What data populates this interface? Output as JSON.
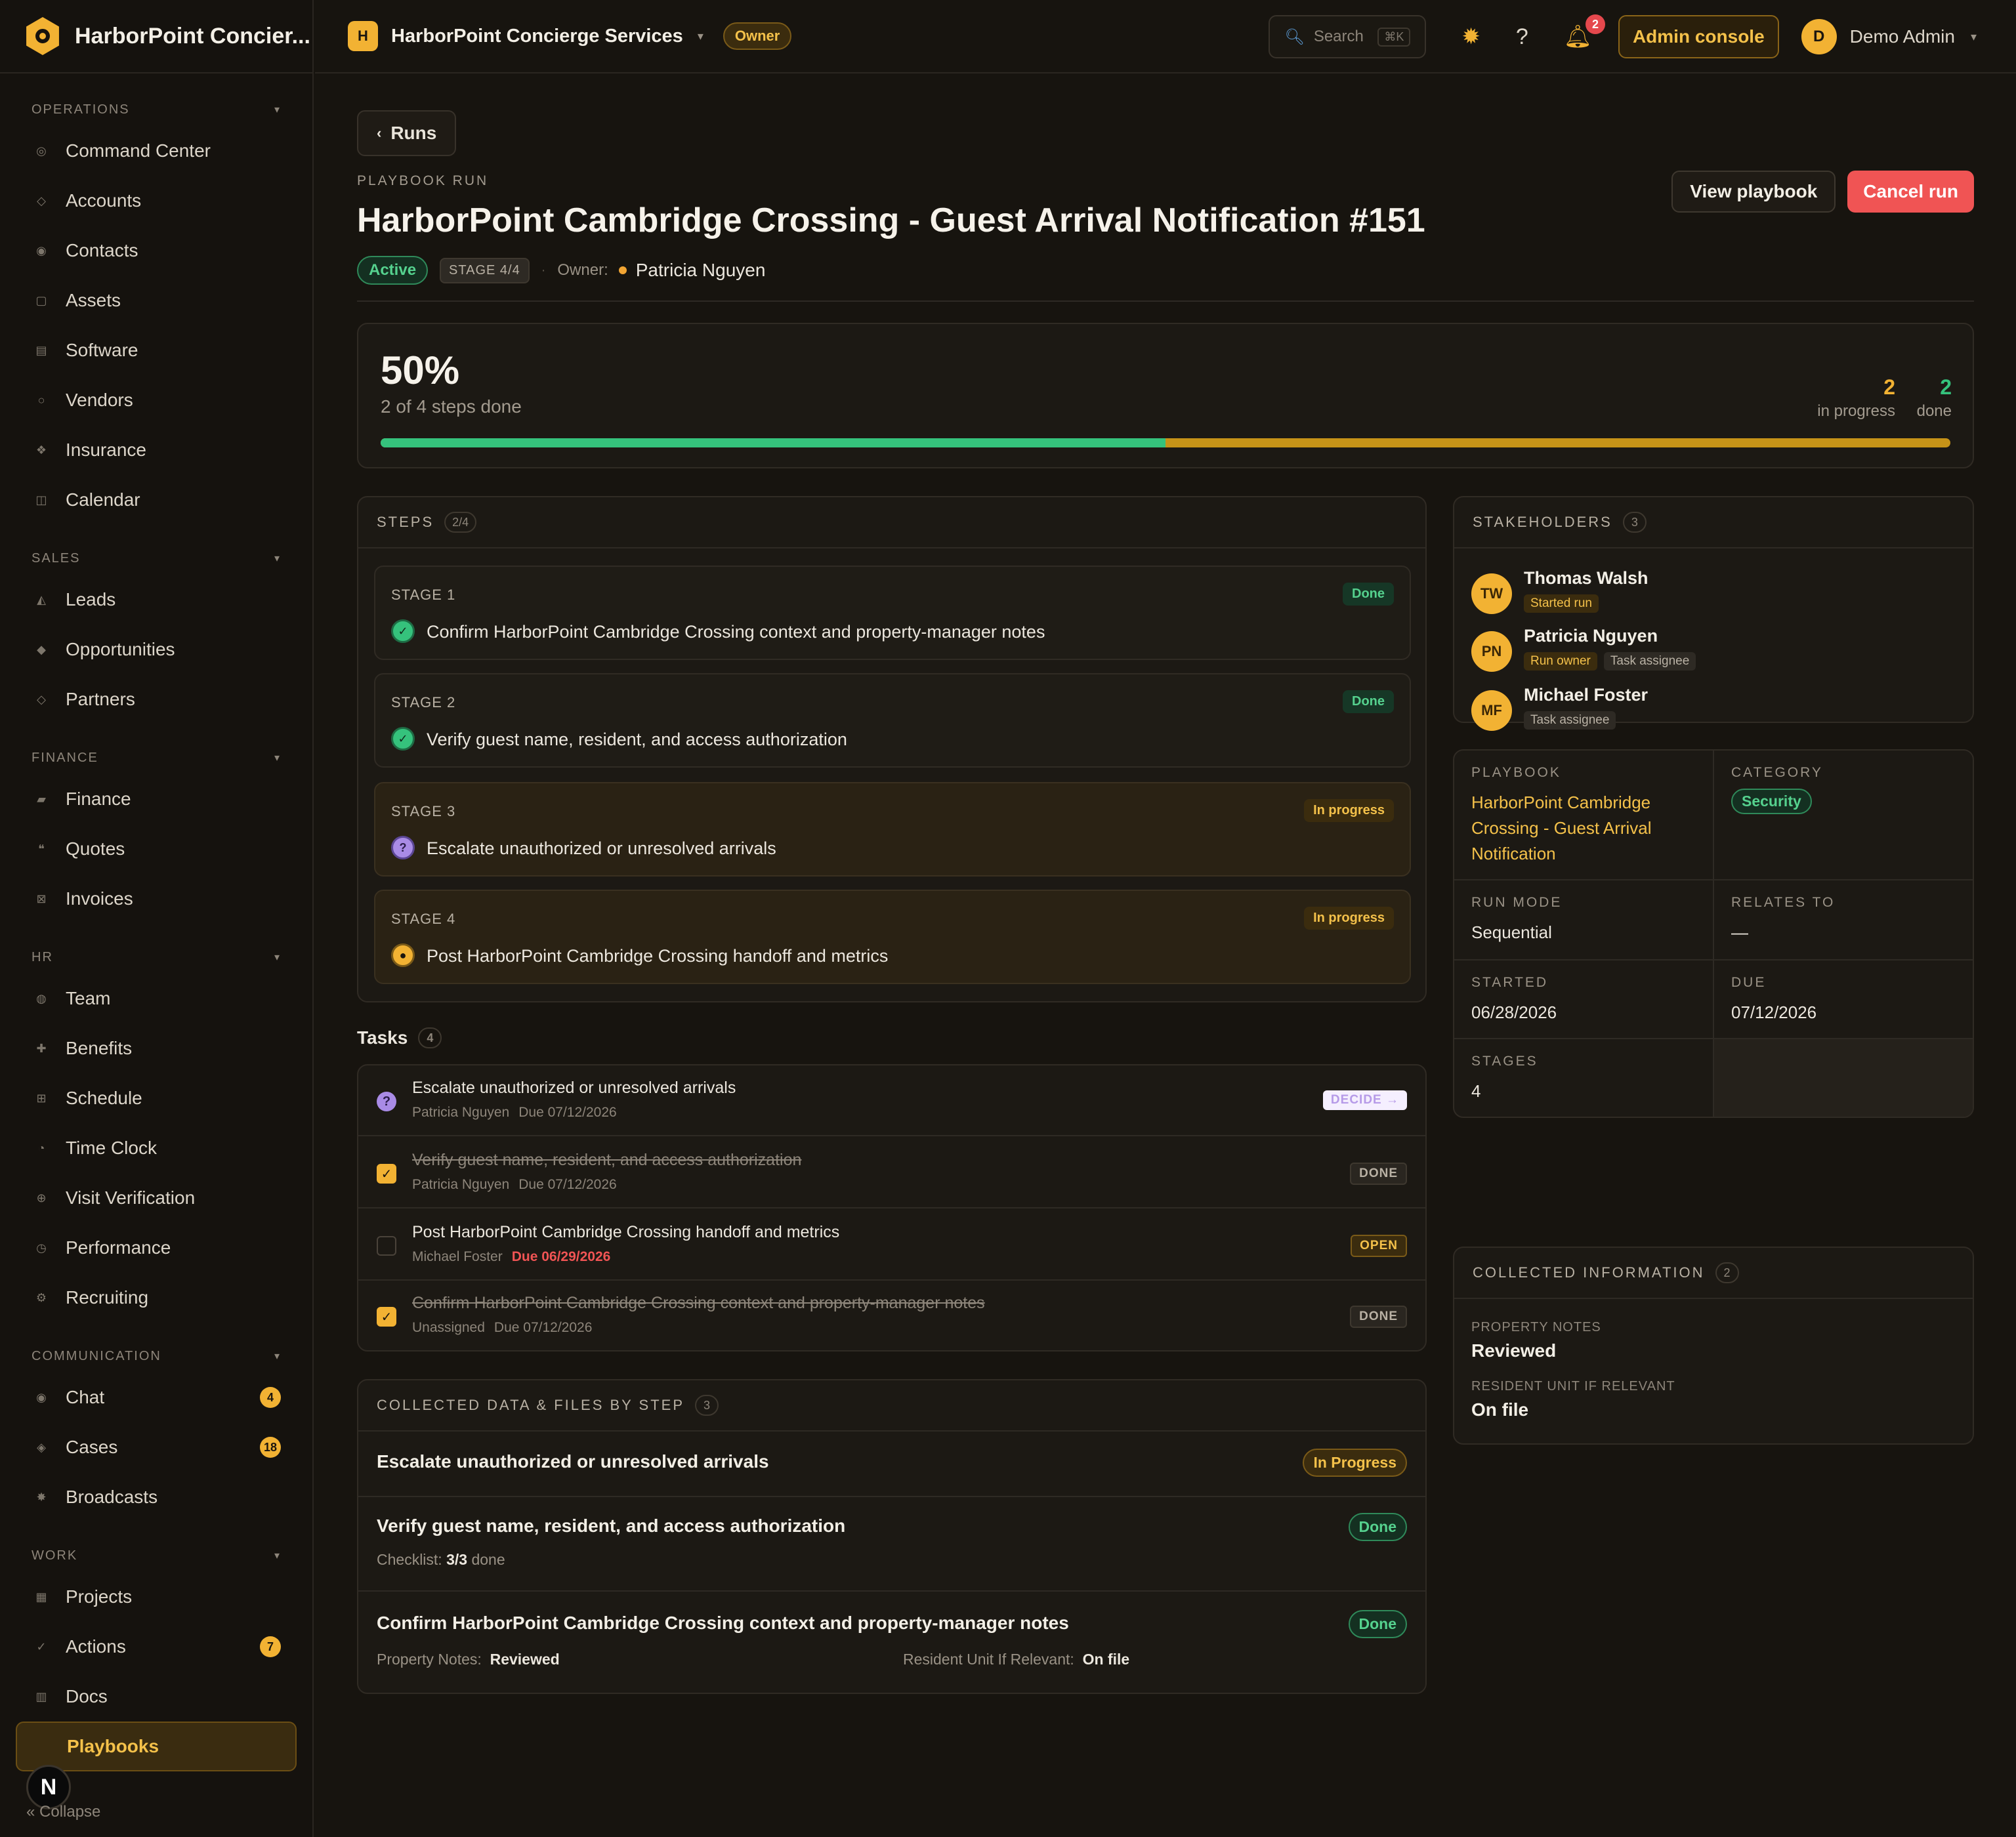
{
  "app": {
    "brand": "HarborPoint Concier...",
    "workspace": "HarborPoint Concierge Services",
    "role_badge": "Owner",
    "search_placeholder": "Search",
    "search_shortcut": "⌘K",
    "notifications_count": "2",
    "admin_console": "Admin console",
    "user_initial": "D",
    "user_name": "Demo Admin"
  },
  "sidebar": {
    "sections": [
      {
        "heading": "OPERATIONS",
        "items": [
          {
            "label": "Command Center",
            "icon": "target-icon"
          },
          {
            "label": "Accounts",
            "icon": "diamond-icon"
          },
          {
            "label": "Contacts",
            "icon": "person-icon"
          },
          {
            "label": "Assets",
            "icon": "box-icon"
          },
          {
            "label": "Software",
            "icon": "grid-icon"
          },
          {
            "label": "Vendors",
            "icon": "circle-icon"
          },
          {
            "label": "Insurance",
            "icon": "shield-icon"
          },
          {
            "label": "Calendar",
            "icon": "calendar-icon"
          }
        ]
      },
      {
        "heading": "SALES",
        "items": [
          {
            "label": "Leads",
            "icon": "triangle-icon"
          },
          {
            "label": "Opportunities",
            "icon": "diamond-filled-icon"
          },
          {
            "label": "Partners",
            "icon": "diamond-icon"
          }
        ]
      },
      {
        "heading": "FINANCE",
        "items": [
          {
            "label": "Finance",
            "icon": "card-icon"
          },
          {
            "label": "Quotes",
            "icon": "quote-icon"
          },
          {
            "label": "Invoices",
            "icon": "invoice-icon"
          }
        ]
      },
      {
        "heading": "HR",
        "items": [
          {
            "label": "Team",
            "icon": "team-icon"
          },
          {
            "label": "Benefits",
            "icon": "plus-icon"
          },
          {
            "label": "Schedule",
            "icon": "schedule-icon"
          },
          {
            "label": "Time Clock",
            "icon": "clock-icon"
          },
          {
            "label": "Visit Verification",
            "icon": "globe-icon"
          },
          {
            "label": "Performance",
            "icon": "gauge-icon"
          },
          {
            "label": "Recruiting",
            "icon": "gear-icon"
          }
        ]
      },
      {
        "heading": "COMMUNICATION",
        "items": [
          {
            "label": "Chat",
            "icon": "chat-icon",
            "badge": "4"
          },
          {
            "label": "Cases",
            "icon": "case-icon",
            "badge": "18"
          },
          {
            "label": "Broadcasts",
            "icon": "broadcast-icon"
          }
        ]
      },
      {
        "heading": "WORK",
        "items": [
          {
            "label": "Projects",
            "icon": "projects-icon"
          },
          {
            "label": "Actions",
            "icon": "check-icon",
            "badge": "7"
          },
          {
            "label": "Docs",
            "icon": "doc-icon"
          }
        ]
      }
    ],
    "active_item": "Playbooks",
    "collapse_label": "« Collapse",
    "bottom_avatar": "N"
  },
  "run": {
    "back_label": "Runs",
    "eyebrow": "PLAYBOOK RUN",
    "title": "HarborPoint Cambridge Crossing - Guest Arrival Notification #151",
    "status": "Active",
    "stage_chip": "STAGE 4/4",
    "owner_label": "Owner:",
    "owner_name": "Patricia Nguyen",
    "view_playbook": "View playbook",
    "cancel_run": "Cancel run"
  },
  "progress": {
    "percent_label": "50%",
    "percent_value": 0.5,
    "subtitle": "2 of 4 steps done",
    "in_progress_count": "2",
    "in_progress_label": "in progress",
    "done_count": "2",
    "done_label": "done"
  },
  "steps": {
    "heading": "STEPS",
    "count": "2/4",
    "items": [
      {
        "stage": "STAGE 1",
        "text": "Confirm HarborPoint Cambridge Crossing context and property-manager notes",
        "status": "Done"
      },
      {
        "stage": "STAGE 2",
        "text": "Verify guest name, resident, and access authorization",
        "status": "Done"
      },
      {
        "stage": "STAGE 3",
        "text": "Escalate unauthorized or unresolved arrivals",
        "status": "In progress"
      },
      {
        "stage": "STAGE 4",
        "text": "Post HarborPoint Cambridge Crossing handoff and metrics",
        "status": "In progress"
      }
    ]
  },
  "tasks": {
    "heading": "Tasks",
    "count": "4",
    "items": [
      {
        "title": "Escalate unauthorized or unresolved arrivals",
        "assignee": "Patricia Nguyen",
        "due": "Due 07/12/2026",
        "tag": "DECIDE →"
      },
      {
        "title": "Verify guest name, resident, and access authorization",
        "assignee": "Patricia Nguyen",
        "due": "Due 07/12/2026",
        "tag": "DONE"
      },
      {
        "title": "Post HarborPoint Cambridge Crossing handoff and metrics",
        "assignee": "Michael Foster",
        "due": "Due 06/29/2026",
        "tag": "OPEN"
      },
      {
        "title": "Confirm HarborPoint Cambridge Crossing context and property-manager notes",
        "assignee": "Unassigned",
        "due": "Due 07/12/2026",
        "tag": "DONE"
      }
    ]
  },
  "collected_data": {
    "heading": "COLLECTED DATA & FILES BY STEP",
    "count": "3",
    "rows": [
      {
        "title": "Escalate unauthorized or unresolved arrivals",
        "status": "In Progress"
      },
      {
        "title": "Verify guest name, resident, and access authorization",
        "status": "Done",
        "checklist_label": "Checklist:",
        "checklist_value": "3/3",
        "checklist_suffix": "done"
      },
      {
        "title": "Confirm HarborPoint Cambridge Crossing context and property-manager notes",
        "status": "Done",
        "field1_label": "Property Notes:",
        "field1_value": "Reviewed",
        "field2_label": "Resident Unit If Relevant:",
        "field2_value": "On file"
      }
    ]
  },
  "stakeholders": {
    "heading": "STAKEHOLDERS",
    "count": "3",
    "people": [
      {
        "initials": "TW",
        "name": "Thomas Walsh",
        "roles": [
          "Started run"
        ]
      },
      {
        "initials": "PN",
        "name": "Patricia Nguyen",
        "roles": [
          "Run owner",
          "Task assignee"
        ]
      },
      {
        "initials": "MF",
        "name": "Michael Foster",
        "roles": [
          "Task assignee"
        ]
      }
    ]
  },
  "details": {
    "playbook_label": "PLAYBOOK",
    "playbook_value": "HarborPoint Cambridge Crossing - Guest Arrival Notification",
    "category_label": "CATEGORY",
    "category_value": "Security",
    "run_mode_label": "RUN MODE",
    "run_mode_value": "Sequential",
    "relates_to_label": "RELATES TO",
    "relates_to_value": "—",
    "started_label": "STARTED",
    "started_value": "06/28/2026",
    "due_label": "DUE",
    "due_value": "07/12/2026",
    "stages_label": "STAGES",
    "stages_value": "4"
  },
  "collected_info": {
    "heading": "COLLECTED INFORMATION",
    "count": "2",
    "items": [
      {
        "label": "PROPERTY NOTES",
        "value": "Reviewed"
      },
      {
        "label": "RESIDENT UNIT IF RELEVANT",
        "value": "On file"
      }
    ]
  },
  "colors": {
    "accent": "#f2b233",
    "success": "#35c27c",
    "danger": "#f05454",
    "background": "#17140f"
  }
}
